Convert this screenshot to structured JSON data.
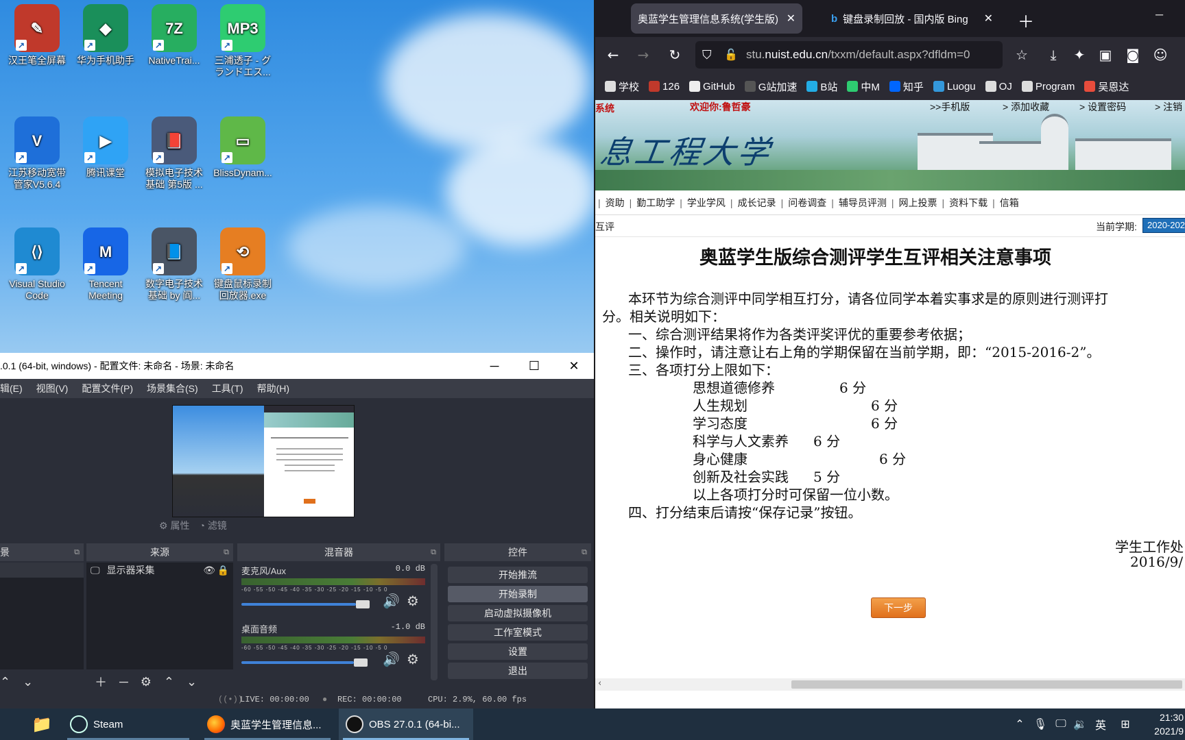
{
  "desktop": {
    "icons": [
      {
        "label": "汉王笔全屏幕",
        "color": "#c0392b",
        "glyph": "✎"
      },
      {
        "label": "华为手机助手",
        "color": "#1a8f5a",
        "glyph": "◆"
      },
      {
        "label": "NativeTrai...",
        "color": "#27ae60",
        "glyph": "7Z"
      },
      {
        "label": "三浦透子 - グランドエス...",
        "color": "#2ecc71",
        "glyph": "MP3"
      },
      {
        "label": "江苏移动宽带管家V5.6.4",
        "color": "#1e6fd9",
        "glyph": "V"
      },
      {
        "label": "腾讯课堂",
        "color": "#2fa3f5",
        "glyph": "▶"
      },
      {
        "label": "模拟电子技术基础 第5版 ...",
        "color": "#4a5a7a",
        "glyph": "📕"
      },
      {
        "label": "BlissDynam...",
        "color": "#5fb848",
        "glyph": "▭"
      },
      {
        "label": "Visual Studio Code",
        "color": "#1f8ad2",
        "glyph": "⟨⟩"
      },
      {
        "label": "Tencent Meeting",
        "color": "#1766e6",
        "glyph": "M"
      },
      {
        "label": "数字电子技术基础 by 阎...",
        "color": "#4a5565",
        "glyph": "📘"
      },
      {
        "label": "键盘鼠标录制回放器.exe",
        "color": "#e67e22",
        "glyph": "⟲"
      }
    ]
  },
  "obs": {
    "title": ".0.1 (64-bit, windows) - 配置文件: 未命名 - 场景: 未命名",
    "menu": [
      "辑(E)",
      "视图(V)",
      "配置文件(P)",
      "场景集合(S)",
      "工具(T)",
      "帮助(H)"
    ],
    "prop_label": "属性",
    "filter_label": "滤镜",
    "docks": {
      "scenes": "景",
      "sources": "来源",
      "mixer": "混音器",
      "controls": "控件"
    },
    "source_item": "显示器采集",
    "mixer": [
      {
        "name": "麦克风/Aux",
        "db": "0.0 dB",
        "level": 0.95
      },
      {
        "name": "桌面音频",
        "db": "-1.0 dB",
        "level": 0.93
      }
    ],
    "ticks": "-60 -55 -50 -45 -40 -35 -30 -25 -20 -15 -10 -5 0",
    "controls": [
      "开始推流",
      "开始录制",
      "启动虚拟摄像机",
      "工作室模式",
      "设置",
      "退出"
    ],
    "status": {
      "live": "LIVE: 00:00:00",
      "rec": "REC: 00:00:00",
      "cpu": "CPU: 2.9%, 60.00 fps"
    }
  },
  "browser": {
    "tabs": [
      {
        "title": "奥蓝学生管理信息系统(学生版)",
        "active": true
      },
      {
        "title": "键盘录制回放 - 国内版 Bing",
        "active": false
      }
    ],
    "url_prefix": "stu.",
    "url_domain": "nuist.edu.cn",
    "url_rest": "/txxm/default.aspx?dfldm=0",
    "bookmarks": [
      {
        "label": "学校",
        "color": "#ddd"
      },
      {
        "label": "126",
        "color": "#c0392b"
      },
      {
        "label": "GitHub",
        "color": "#eee"
      },
      {
        "label": "G站加速",
        "color": "#555"
      },
      {
        "label": "B站",
        "color": "#23ade5"
      },
      {
        "label": "中M",
        "color": "#2ecc71"
      },
      {
        "label": "知乎",
        "color": "#0066ff"
      },
      {
        "label": "Luogu",
        "color": "#3498db"
      },
      {
        "label": "OJ",
        "color": "#ddd"
      },
      {
        "label": "Program",
        "color": "#ddd"
      },
      {
        "label": "吴恩达",
        "color": "#e74c3c"
      }
    ]
  },
  "site": {
    "sys_tag": "系统",
    "welcome": "欢迎你:鲁哲豪",
    "links": [
      ">>手机版",
      "> 添加收藏",
      "> 设置密码",
      "> 注销"
    ],
    "calligraphy": "息工程大学",
    "nav": [
      "资助",
      "勤工助学",
      "学业学风",
      "成长记录",
      "问卷调查",
      "辅导员评测",
      "网上投票",
      "资料下载",
      "信箱"
    ],
    "crumb": "互评",
    "term_label": "当前学期:",
    "term_value": "2020-202",
    "title": "奥蓝学生版综合测评学生互评相关注意事项",
    "para1": "本环节为综合测评中同学相互打分，请各位同学本着实事求是的原则进行测评打",
    "para1b": "分。相关说明如下：",
    "item1": "一、综合测评结果将作为各类评奖评优的重要参考依据；",
    "item2": "二、操作时，请注意让右上角的学期保留在当前学期，即：“2015-2016-2”。",
    "item3": "三、各项打分上限如下：",
    "scores": [
      {
        "name": "思想道德修养",
        "value": "6 分"
      },
      {
        "name": "人生规划",
        "value": "6 分"
      },
      {
        "name": "学习态度",
        "value": "6 分"
      },
      {
        "name": "科学与人文素养",
        "value": "6 分"
      },
      {
        "name": "身心健康",
        "value": "6 分"
      },
      {
        "name": "创新及社会实践",
        "value": "5 分"
      }
    ],
    "note": "以上各项打分时可保留一位小数。",
    "item4": "四、打分结束后请按“保存记录”按钮。",
    "sign": "学生工作处",
    "date": "2016/9/",
    "next": "下一步"
  },
  "taskbar": {
    "steam": "Steam",
    "firefox": "奥蓝学生管理信息...",
    "obs": "OBS 27.0.1 (64-bi...",
    "ime": "英",
    "time": "21:30",
    "date": "2021/9"
  }
}
